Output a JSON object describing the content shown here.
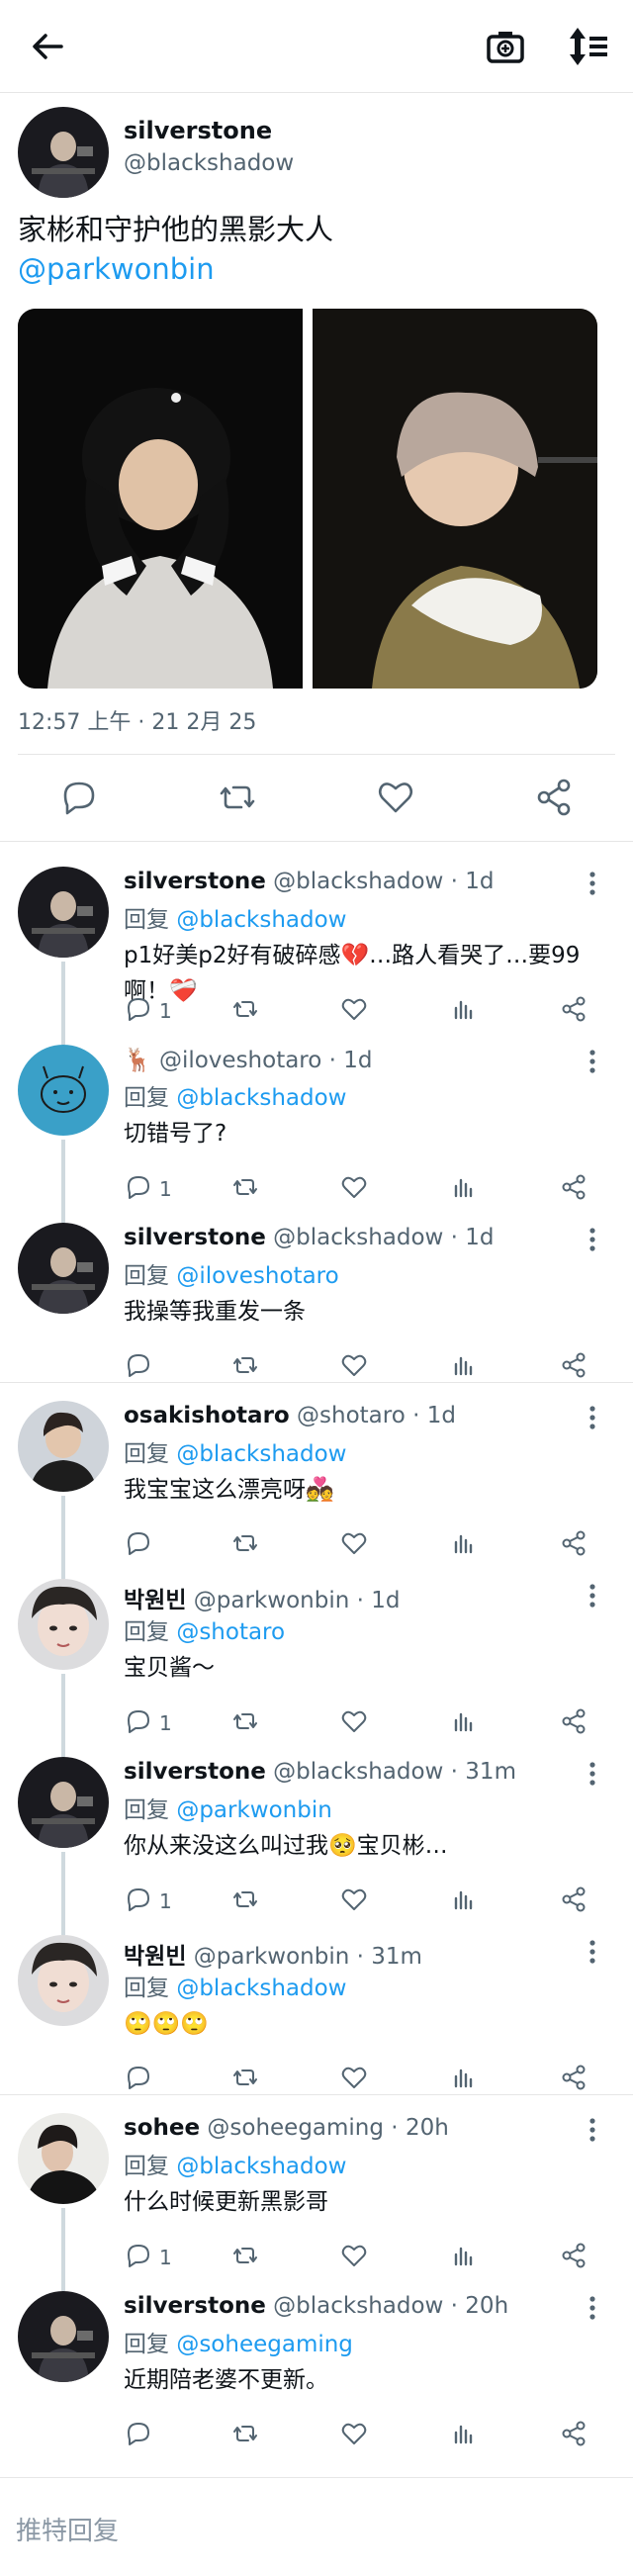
{
  "colors": {
    "accent": "#1d9bf0",
    "muted": "#536471",
    "divider": "#e6e6e6",
    "heart": "#f91880"
  },
  "header": {
    "back_icon": "back-arrow-icon",
    "camera_icon": "camera-icon",
    "sort_icon": "sort-icon"
  },
  "main_tweet": {
    "name": "silverstone",
    "handle": "@blackshadow",
    "text": "家彬和守护他的黑影大人",
    "mention": "@parkwonbin",
    "time": "12:57 上午 · 21 2月 25"
  },
  "replies": [
    {
      "name": "silverstone",
      "handle": "@blackshadow",
      "time": "1d",
      "reply_label": "回复",
      "reply_to": "@blackshadow",
      "text": "p1好美p2好有破碎感💔…路人看哭了…要99啊！❤️‍🩹",
      "reply_count": "1"
    },
    {
      "name": "🦌",
      "handle": "@iloveshotaro",
      "time": "1d",
      "reply_label": "回复",
      "reply_to": "@blackshadow",
      "text": "切错号了?",
      "reply_count": "1"
    },
    {
      "name": "silverstone",
      "handle": "@blackshadow",
      "time": "1d",
      "reply_label": "回复",
      "reply_to": "@iloveshotaro",
      "text": "我操等我重发一条",
      "reply_count": ""
    },
    {
      "name": "osakishotaro",
      "handle": "@shotaro",
      "time": "1d",
      "reply_label": "回复",
      "reply_to": "@blackshadow",
      "text": "我宝宝这么漂亮呀💑",
      "reply_count": ""
    },
    {
      "name": "박원빈",
      "handle": "@parkwonbin",
      "time": "1d",
      "reply_label": "回复",
      "reply_to": "@shotaro",
      "text": "宝贝酱～",
      "reply_count": "1"
    },
    {
      "name": "silverstone",
      "handle": "@blackshadow",
      "time": "31m",
      "reply_label": "回复",
      "reply_to": "@parkwonbin",
      "text": "你从来没这么叫过我🥺宝贝彬…",
      "reply_count": "1"
    },
    {
      "name": "박원빈",
      "handle": "@parkwonbin",
      "time": "31m",
      "reply_label": "回复",
      "reply_to": "@blackshadow",
      "text": "🙄🙄🙄",
      "reply_count": ""
    },
    {
      "name": "sohee",
      "handle": "@soheegaming",
      "time": "20h",
      "reply_label": "回复",
      "reply_to": "@blackshadow",
      "text": "什么时候更新黑影哥",
      "reply_count": "1"
    },
    {
      "name": "silverstone",
      "handle": "@blackshadow",
      "time": "20h",
      "reply_label": "回复",
      "reply_to": "@soheegaming",
      "text": "近期陪老婆不更新。",
      "reply_count": ""
    }
  ],
  "bottom": {
    "placeholder": "推特回复"
  }
}
